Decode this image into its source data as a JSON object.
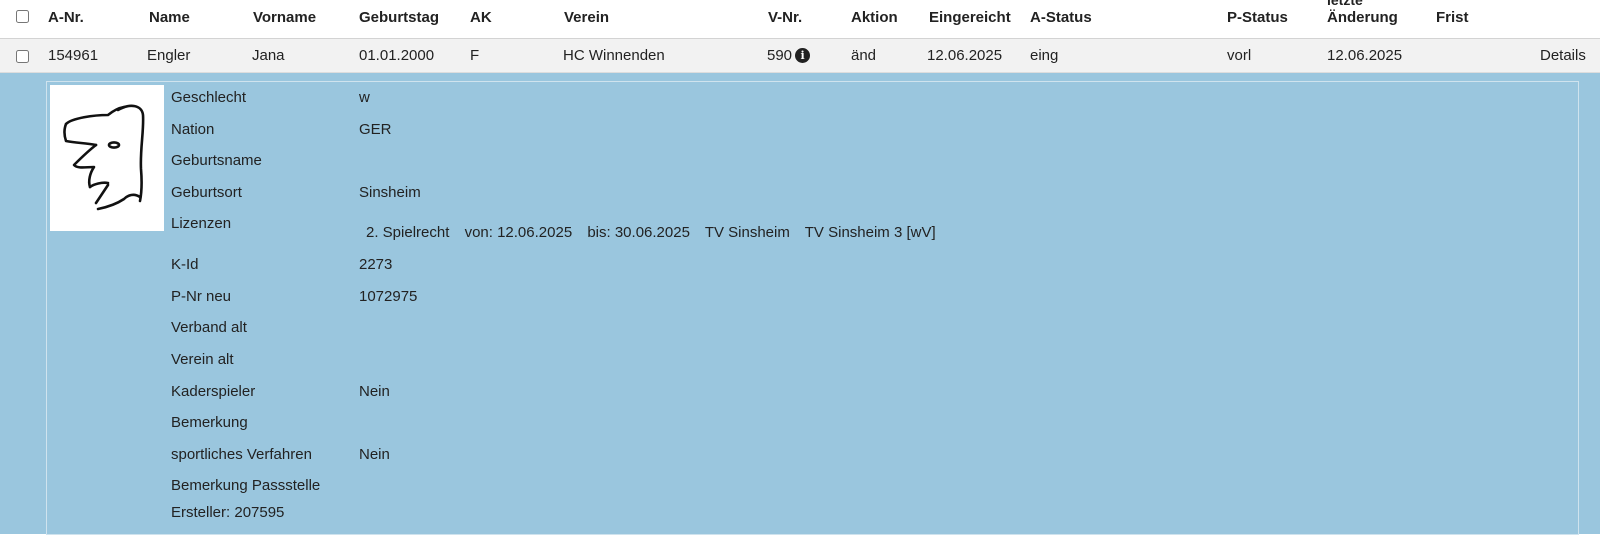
{
  "header": {
    "columns": [
      "A-Nr.",
      "Name",
      "Vorname",
      "Geburtstag",
      "AK",
      "Verein",
      "V-Nr.",
      "Aktion",
      "Eingereicht",
      "A-Status",
      "P-Status",
      "Änderung",
      "Frist"
    ],
    "cut_off_label": "letzte"
  },
  "row": {
    "a_nr": "154961",
    "name": "Engler",
    "vorname": "Jana",
    "geburtstag": "01.01.2000",
    "ak": "F",
    "verein": "HC Winnenden",
    "v_nr": "590",
    "info_glyph": "i",
    "aktion": "änd",
    "eingereicht": "12.06.2025",
    "a_status": "eing",
    "p_status": "vorl",
    "aenderung": "12.06.2025",
    "frist": "",
    "details_link": "Details"
  },
  "details": {
    "geschlecht": {
      "label": "Geschlecht",
      "value": "w"
    },
    "nation": {
      "label": "Nation",
      "value": "GER"
    },
    "geburtsname": {
      "label": "Geburtsname",
      "value": ""
    },
    "geburtsort": {
      "label": "Geburtsort",
      "value": "Sinsheim"
    },
    "lizenzen": {
      "label": "Lizenzen",
      "entry": {
        "typ": "2. Spielrecht",
        "von": "von: 12.06.2025",
        "bis": "bis: 30.06.2025",
        "verein": "TV Sinsheim",
        "mannschaft": "TV Sinsheim 3 [wV]"
      }
    },
    "k_id": {
      "label": "K-Id",
      "value": "2273"
    },
    "p_nr_neu": {
      "label": "P-Nr neu",
      "value": "1072975"
    },
    "verband_alt": {
      "label": "Verband alt",
      "value": ""
    },
    "verein_alt": {
      "label": "Verein alt",
      "value": ""
    },
    "kaderspieler": {
      "label": "Kaderspieler",
      "value": "Nein"
    },
    "bemerkung": {
      "label": "Bemerkung",
      "value": ""
    },
    "sportliches_verfahren": {
      "label": "sportliches Verfahren",
      "value": "Nein"
    },
    "bemerkung_passstelle": {
      "label": "Bemerkung Passstelle",
      "value": ""
    },
    "ersteller": "Ersteller: 207595"
  },
  "colors": {
    "detail_background": "#9ac6de",
    "link": "#337ab7",
    "row_background": "#f2f2f2"
  },
  "icons": {
    "info": "info-circle-icon",
    "photo": "player-photo-sketch"
  }
}
